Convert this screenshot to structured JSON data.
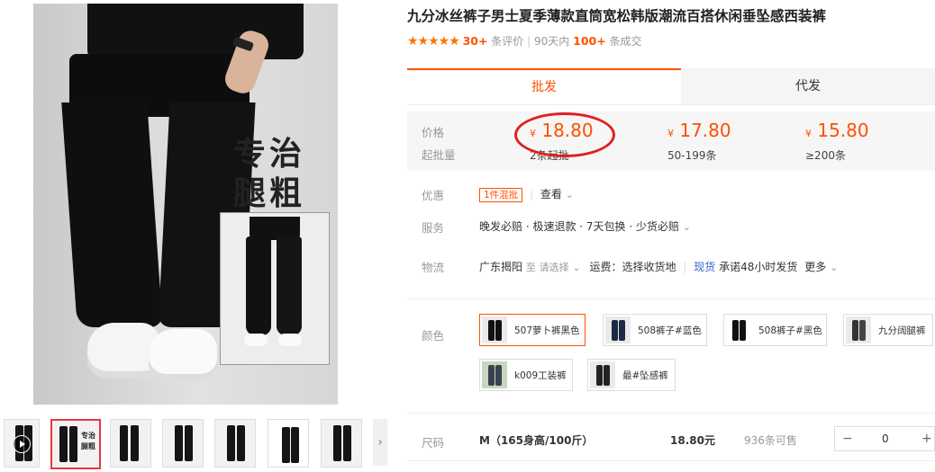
{
  "gallery": {
    "main_text_1": "专治",
    "main_text_2": "腿粗",
    "next_arrow": "›",
    "thumb_labels": [
      "专治",
      "腿粗"
    ]
  },
  "product": {
    "title": "九分冰丝裤子男士夏季薄款直筒宽松韩版潮流百搭休闲垂坠感西装裤",
    "rating": {
      "stars": 5,
      "review_count": "30+",
      "review_label": "条评价",
      "period": "90天内",
      "sold_count": "100+",
      "sold_label": "条成交"
    }
  },
  "tabs": [
    {
      "label": "批发",
      "active": true
    },
    {
      "label": "代发",
      "active": false
    }
  ],
  "pricing": {
    "price_label": "价格",
    "moq_label": "起批量",
    "currency": "¥",
    "tiers": [
      {
        "price": "18.80",
        "qty": "2条起批"
      },
      {
        "price": "17.80",
        "qty": "50-199条"
      },
      {
        "price": "15.80",
        "qty": "≥200条"
      }
    ]
  },
  "promo": {
    "label": "优惠",
    "tag": "1件混批",
    "link": "查看"
  },
  "service": {
    "label": "服务",
    "text": "晚发必赔 · 极速退款 · 7天包换 · 少货必赔"
  },
  "logistics": {
    "label": "物流",
    "origin": "广东揭阳",
    "to": "至",
    "dest_placeholder": "请选择",
    "fee": "运费：选择收货地",
    "stock": "现货",
    "promise": "承诺48小时发货",
    "more": "更多"
  },
  "colors": {
    "label": "颜色",
    "options": [
      {
        "name": "507萝卜裤黑色",
        "selected": true
      },
      {
        "name": "508裤子#蓝色",
        "selected": false
      },
      {
        "name": "508裤子#黑色",
        "selected": false
      },
      {
        "name": "九分阔腿裤",
        "selected": false
      },
      {
        "name": "k009工装裤",
        "selected": false
      },
      {
        "name": "最#坠感裤",
        "selected": false
      }
    ]
  },
  "size": {
    "label": "尺码",
    "name": "M（165身高/100斤）",
    "price": "18.80元",
    "stock": "936条可售",
    "minus": "−",
    "quantity": "0",
    "plus": "+"
  },
  "theme": {
    "accent": "#ff5000",
    "highlight_circle": "#e02020"
  }
}
